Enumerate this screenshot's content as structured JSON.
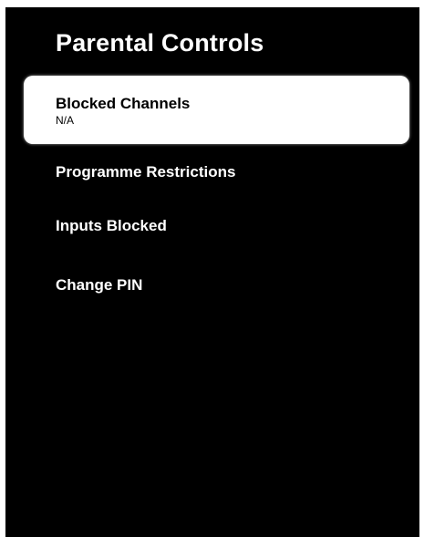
{
  "page": {
    "title": "Parental Controls"
  },
  "menu": {
    "items": [
      {
        "label": "Blocked Channels",
        "value": "N/A",
        "selected": true
      },
      {
        "label": "Programme Restrictions"
      },
      {
        "label": "Inputs Blocked"
      },
      {
        "label": "Change PIN"
      }
    ]
  },
  "colors": {
    "background": "#000000",
    "text": "#ffffff",
    "selected_background": "#ffffff",
    "selected_text": "#000000"
  }
}
